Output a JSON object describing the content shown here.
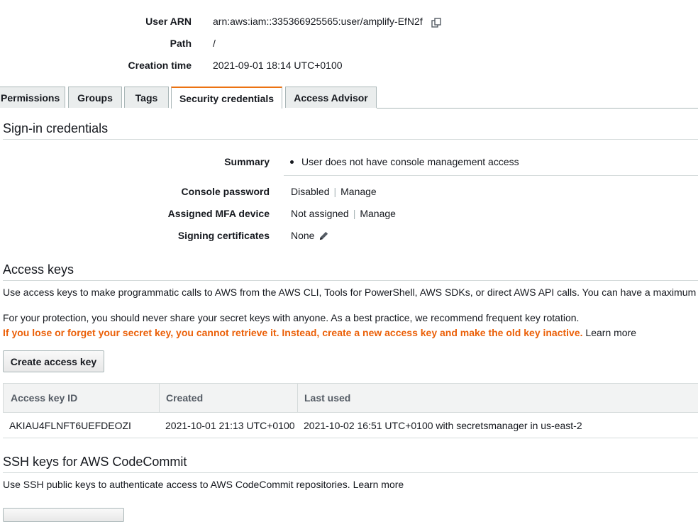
{
  "summary": {
    "user_arn_label": "User ARN",
    "user_arn_value": "arn:aws:iam::335366925565:user/amplify-EfN2f",
    "path_label": "Path",
    "path_value": "/",
    "creation_time_label": "Creation time",
    "creation_time_value": "2021-09-01 18:14 UTC+0100"
  },
  "tabs": [
    {
      "label": "Permissions"
    },
    {
      "label": "Groups"
    },
    {
      "label": "Tags"
    },
    {
      "label": "Security credentials",
      "active": true
    },
    {
      "label": "Access Advisor"
    }
  ],
  "signin": {
    "heading": "Sign-in credentials",
    "summary_label": "Summary",
    "summary_item": "User does not have console management access",
    "console_password_label": "Console password",
    "console_password_value": "Disabled",
    "console_password_action": "Manage",
    "mfa_label": "Assigned MFA device",
    "mfa_value": "Not assigned",
    "mfa_action": "Manage",
    "signing_label": "Signing certificates",
    "signing_value": "None"
  },
  "access_keys": {
    "heading": "Access keys",
    "description": "Use access keys to make programmatic calls to AWS from the AWS CLI, Tools for PowerShell, AWS SDKs, or direct AWS API calls. You can have a maximum of",
    "protection_note": "For your protection, you should never share your secret keys with anyone. As a best practice, we recommend frequent key rotation.",
    "warning": "If you lose or forget your secret key, you cannot retrieve it. Instead, create a new access key and make the old key inactive.",
    "learn_more": "Learn more",
    "create_button": "Create access key",
    "columns": [
      "Access key ID",
      "Created",
      "Last used"
    ],
    "rows": [
      {
        "id": "AKIAU4FLNFT6UEFDEOZI",
        "created": "2021-10-01 21:13 UTC+0100",
        "last_used": "2021-10-02 16:51 UTC+0100 with secretsmanager in us-east-2"
      }
    ]
  },
  "ssh": {
    "heading": "SSH keys for AWS CodeCommit",
    "description": "Use SSH public keys to authenticate access to AWS CodeCommit repositories.",
    "learn_more": "Learn more"
  },
  "icons": {
    "copy": "copy-icon",
    "edit": "pencil-icon",
    "bullet": "bullet-icon"
  },
  "colors": {
    "accent": "#ec7211",
    "warning": "#eb5f07"
  }
}
